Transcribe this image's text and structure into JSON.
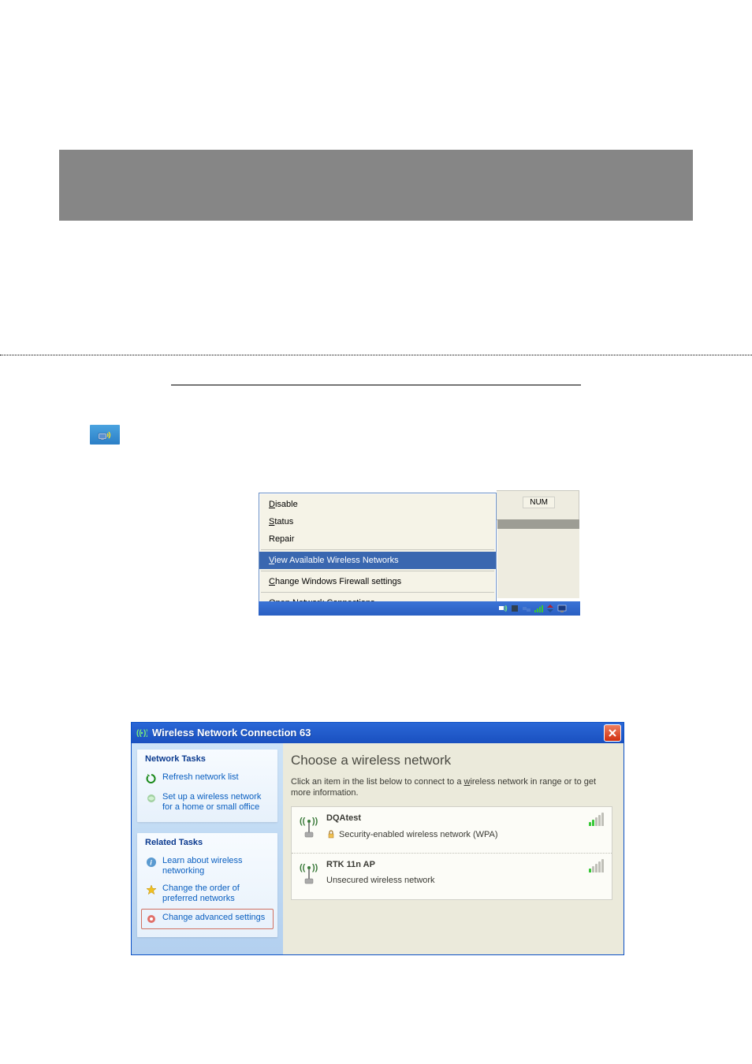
{
  "num_indicator": "NUM",
  "context_menu": {
    "items": [
      {
        "label": "Disable",
        "underline_index": 0
      },
      {
        "label": "Status",
        "underline_index": 0
      },
      {
        "label": "Repair",
        "underline_index": null
      }
    ],
    "highlighted": {
      "label": "View Available Wireless Networks",
      "underline_index": 0
    },
    "firewall": {
      "label": "Change Windows Firewall settings",
      "underline_index": 0
    },
    "open_net": {
      "label": "Open Network Connections",
      "underline_index": 0
    }
  },
  "wifi_window": {
    "title": "Wireless Network Connection 63",
    "sidebar": {
      "group1_header": "Network Tasks",
      "link_refresh": "Refresh network list",
      "link_setup": "Set up a wireless network for a home or small office",
      "group2_header": "Related Tasks",
      "link_learn": "Learn about wireless networking",
      "link_order": "Change the order of preferred networks",
      "link_advanced": "Change advanced settings"
    },
    "main": {
      "heading": "Choose a wireless network",
      "desc_pre": "Click an item in the list below to connect to a ",
      "desc_wireless": "w",
      "desc_rest": "ireless network in range or to get more information.",
      "networks": [
        {
          "name": "DQAtest",
          "subtitle": "Security-enabled wireless network (WPA)",
          "secured": true,
          "signal": 2
        },
        {
          "name": "RTK 11n AP",
          "subtitle": "Unsecured wireless network",
          "secured": false,
          "signal": 1
        }
      ]
    }
  }
}
